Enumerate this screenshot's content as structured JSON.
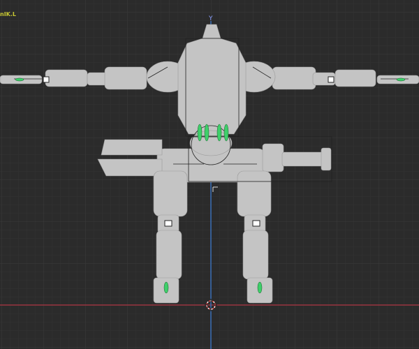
{
  "viewport": {
    "active_bone_label": "nIK.L",
    "axis_label": "Y",
    "colors": {
      "background": "#2b2b2b",
      "grid": "#333333",
      "x_axis": "#9a3540",
      "z_axis": "#3b6fb8",
      "mesh": "#c4c4c4",
      "bone_selected": "#3ecf6a"
    }
  }
}
